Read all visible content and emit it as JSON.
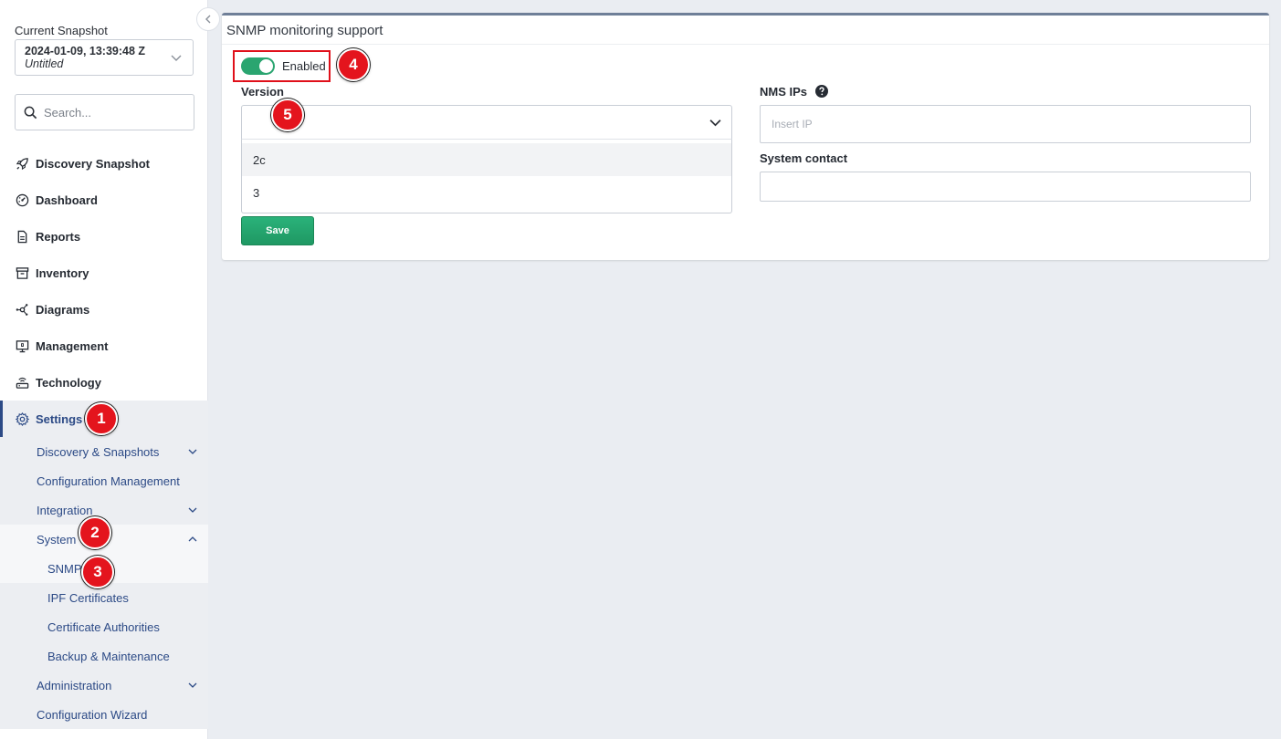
{
  "sidebar": {
    "snapshot_label": "Current Snapshot",
    "snapshot_timestamp": "2024-01-09, 13:39:48 Z",
    "snapshot_name": "Untitled",
    "search_placeholder": "Search...",
    "nav": [
      {
        "label": "Discovery Snapshot",
        "icon": "rocket-icon"
      },
      {
        "label": "Dashboard",
        "icon": "dashboard-icon"
      },
      {
        "label": "Reports",
        "icon": "document-icon"
      },
      {
        "label": "Inventory",
        "icon": "archive-icon"
      },
      {
        "label": "Diagrams",
        "icon": "network-icon"
      },
      {
        "label": "Management",
        "icon": "monitor-icon"
      },
      {
        "label": "Technology",
        "icon": "router-icon"
      }
    ],
    "settings": {
      "label": "Settings",
      "icon": "gear-icon",
      "items": [
        {
          "label": "Discovery & Snapshots"
        },
        {
          "label": "Configuration Management"
        },
        {
          "label": "Integration"
        },
        {
          "label": "System"
        },
        {
          "label": "SNMP"
        },
        {
          "label": "IPF Certificates"
        },
        {
          "label": "Certificate Authorities"
        },
        {
          "label": "Backup & Maintenance"
        },
        {
          "label": "Administration"
        },
        {
          "label": "Configuration Wizard"
        }
      ]
    }
  },
  "main": {
    "card_title": "SNMP monitoring support",
    "toggle_label": "Enabled",
    "toggle_on": true,
    "version_label": "Version",
    "version_value": "",
    "version_options": [
      "2c",
      "3"
    ],
    "save_label": "Save",
    "nms_label": "NMS IPs",
    "nms_placeholder": "Insert IP",
    "contact_label": "System contact",
    "contact_value": ""
  },
  "annotations": [
    "1",
    "2",
    "3",
    "4",
    "5"
  ],
  "colors": {
    "accent": "#2c4a86",
    "toggle_on": "#2aa570",
    "save_button": "#22a46b",
    "badge": "#e4141d",
    "highlight_border": "#e0101a"
  }
}
